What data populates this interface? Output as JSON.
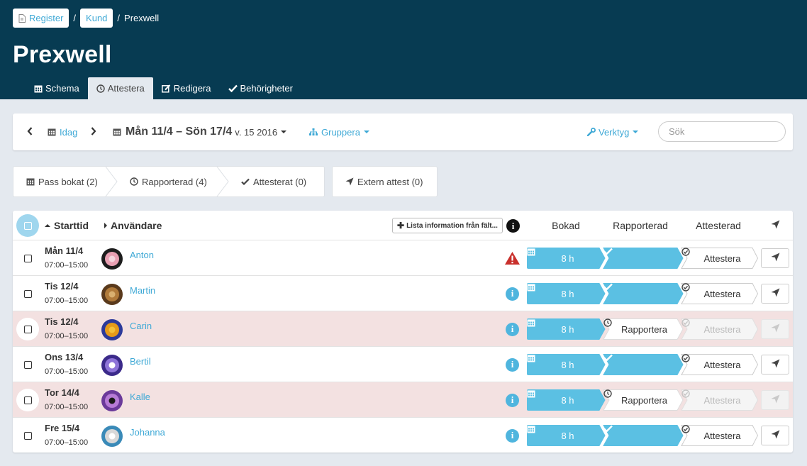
{
  "breadcrumb": {
    "items": [
      {
        "label": "Register"
      },
      {
        "label": "Kund"
      }
    ],
    "separator": "/",
    "current": "Prexwell"
  },
  "page": {
    "title": "Prexwell"
  },
  "tabs": [
    {
      "label": "Schema",
      "icon": "calendar-icon"
    },
    {
      "label": "Attestera",
      "icon": "clock-icon",
      "active": true
    },
    {
      "label": "Redigera",
      "icon": "edit-icon"
    },
    {
      "label": "Behörigheter",
      "icon": "check-icon"
    }
  ],
  "toolbar": {
    "today_label": "Idag",
    "week_range": "Mån 11/4 – Sön 17/4",
    "week_number": "v. 15 2016",
    "group_label": "Gruppera",
    "tools_label": "Verktyg",
    "search_placeholder": "Sök"
  },
  "steps": [
    {
      "label": "Pass bokat (2)",
      "icon": "calendar-icon"
    },
    {
      "label": "Rapporterad (4)",
      "icon": "clock-icon"
    },
    {
      "label": "Attesterat (0)",
      "icon": "check-icon"
    }
  ],
  "external_step": {
    "label": "Extern attest (0)",
    "icon": "paper-plane-icon"
  },
  "table": {
    "headers": {
      "start": "Starttid",
      "user": "Användare",
      "list_button": "Lista information från fält...",
      "info": "i",
      "booked": "Bokad",
      "reported": "Rapporterad",
      "approved": "Attesterad"
    },
    "rows": [
      {
        "day": "Mån 11/4",
        "time": "07:00–15:00",
        "name": "Anton",
        "status": "warning",
        "hours": "8 h",
        "reported": true,
        "report_label": "",
        "approve_label": "Attestera",
        "approve_enabled": true
      },
      {
        "day": "Tis 12/4",
        "time": "07:00–15:00",
        "name": "Martin",
        "status": "info",
        "hours": "8 h",
        "reported": true,
        "report_label": "",
        "approve_label": "Attestera",
        "approve_enabled": true
      },
      {
        "day": "Tis 12/4",
        "time": "07:00–15:00",
        "name": "Carin",
        "status": "info",
        "hours": "8 h",
        "reported": false,
        "report_label": "Rapportera",
        "approve_label": "Attestera",
        "approve_enabled": false
      },
      {
        "day": "Ons 13/4",
        "time": "07:00–15:00",
        "name": "Bertil",
        "status": "info",
        "hours": "8 h",
        "reported": true,
        "report_label": "",
        "approve_label": "Attestera",
        "approve_enabled": true
      },
      {
        "day": "Tor 14/4",
        "time": "07:00–15:00",
        "name": "Kalle",
        "status": "info",
        "hours": "8 h",
        "reported": false,
        "report_label": "Rapportera",
        "approve_label": "Attestera",
        "approve_enabled": false
      },
      {
        "day": "Fre 15/4",
        "time": "07:00–15:00",
        "name": "Johanna",
        "status": "info",
        "hours": "8 h",
        "reported": true,
        "report_label": "",
        "approve_label": "Attestera",
        "approve_enabled": true
      }
    ]
  },
  "colors": {
    "header_bg": "#073b52",
    "accent": "#3fa9d6",
    "pipeline_blue": "#5bc0e3",
    "warning_red": "#c9302c",
    "row_warning_bg": "#f3e1e1"
  }
}
